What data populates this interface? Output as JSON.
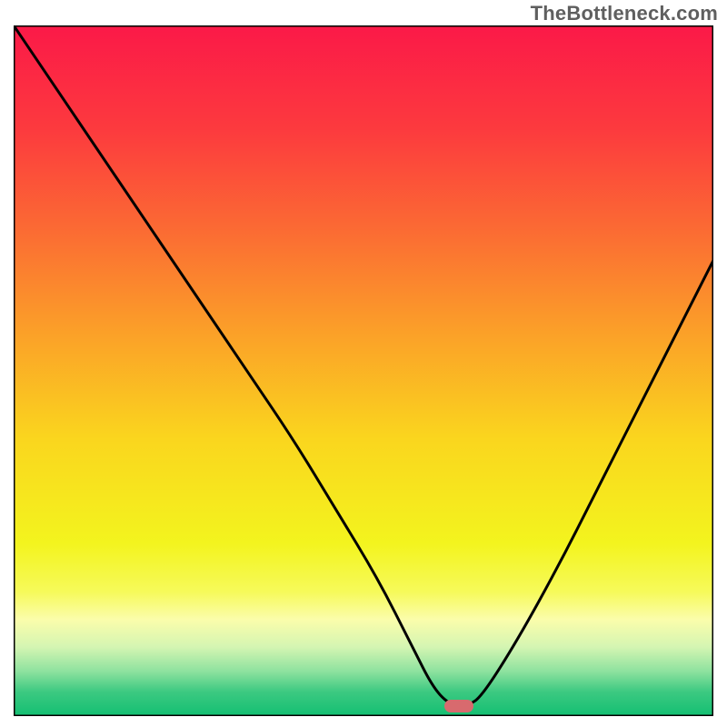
{
  "watermark": "TheBottleneck.com",
  "chart_data": {
    "type": "line",
    "title": "",
    "xlabel": "",
    "ylabel": "",
    "xlim": [
      0,
      100
    ],
    "ylim": [
      0,
      100
    ],
    "grid": false,
    "legend": false,
    "background_gradient": {
      "stops": [
        {
          "pos": 0.0,
          "color": "#fb1948"
        },
        {
          "pos": 0.15,
          "color": "#fc3a3e"
        },
        {
          "pos": 0.3,
          "color": "#fb6c33"
        },
        {
          "pos": 0.45,
          "color": "#fba228"
        },
        {
          "pos": 0.6,
          "color": "#fad61e"
        },
        {
          "pos": 0.75,
          "color": "#f3f41e"
        },
        {
          "pos": 0.82,
          "color": "#f6fa5a"
        },
        {
          "pos": 0.86,
          "color": "#fbfdab"
        },
        {
          "pos": 0.9,
          "color": "#d4f5b2"
        },
        {
          "pos": 0.935,
          "color": "#8ee29f"
        },
        {
          "pos": 0.965,
          "color": "#3cc981"
        },
        {
          "pos": 1.0,
          "color": "#13bf72"
        }
      ]
    },
    "series": [
      {
        "name": "bottleneck-curve",
        "color": "#000000",
        "x": [
          0,
          6,
          12,
          18,
          24,
          28,
          34,
          40,
          46,
          52,
          57,
          60,
          62.5,
          65,
          67,
          72,
          78,
          84,
          90,
          96,
          100
        ],
        "y": [
          100,
          91,
          82,
          73,
          64,
          58,
          49,
          40,
          30,
          20,
          10,
          4,
          1.5,
          1.5,
          3,
          11,
          22,
          34,
          46,
          58,
          66
        ]
      }
    ],
    "marker": {
      "x": 63.7,
      "y": 1.4,
      "color": "#d86a6e"
    }
  }
}
